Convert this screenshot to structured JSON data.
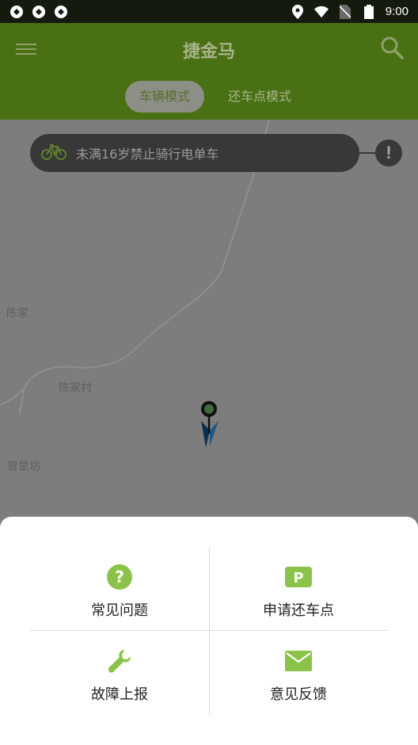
{
  "status_bar": {
    "time": "9:00"
  },
  "app_bar": {
    "title": "捷金马"
  },
  "tabs": [
    {
      "label": "车辆模式",
      "active": true
    },
    {
      "label": "还车点模式",
      "active": false
    }
  ],
  "notice": {
    "text": "未满16岁禁止骑行电单车",
    "alert_symbol": "!"
  },
  "map": {
    "labels": [
      "陈家",
      "陈家村",
      "曾里坊"
    ]
  },
  "menu": {
    "items": [
      {
        "label": "常见问题",
        "icon": "help-circle-icon"
      },
      {
        "label": "申请还车点",
        "icon": "parking-icon"
      },
      {
        "label": "故障上报",
        "icon": "wrench-icon"
      },
      {
        "label": "意见反馈",
        "icon": "mail-icon"
      }
    ]
  },
  "colors": {
    "accent": "#8bc34a",
    "app_bar": "#4a7014"
  }
}
